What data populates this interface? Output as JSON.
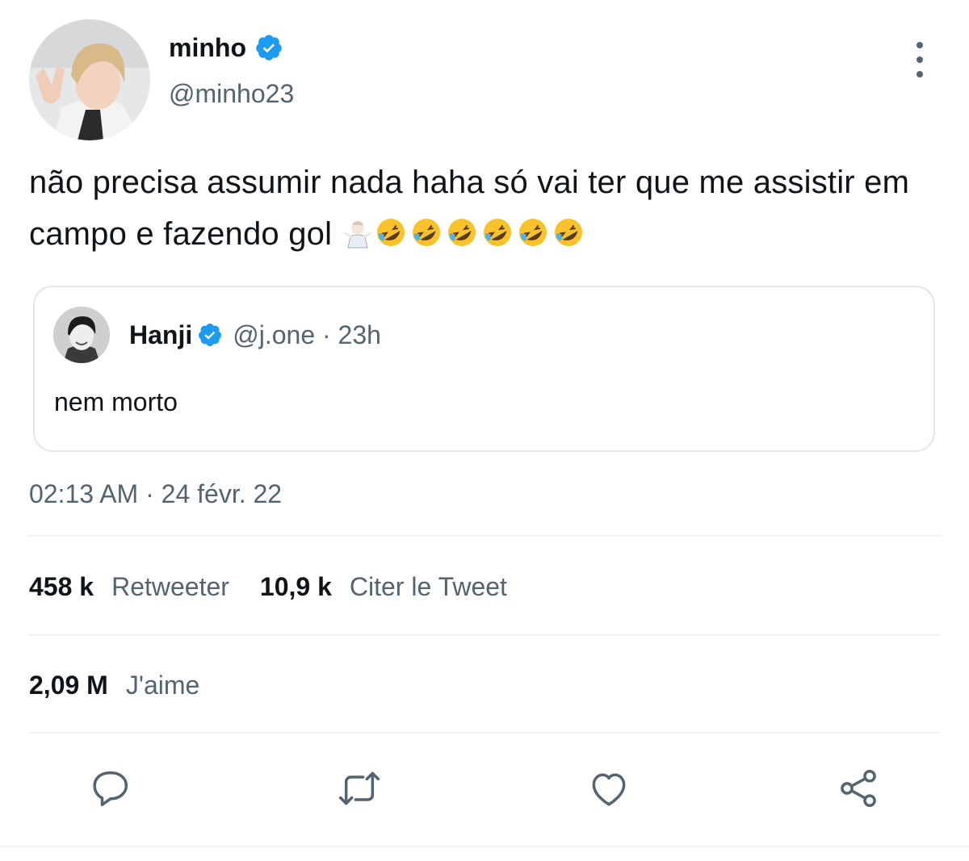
{
  "tweet": {
    "author": {
      "name": "minho",
      "handle": "@minho23",
      "verified": true
    },
    "text": "não precisa assumir nada haha só vai ter que me assistir em campo e fazendo gol",
    "emojis": [
      "man-shrugging-emoji",
      "rolling-on-floor-laughing-emoji",
      "rolling-on-floor-laughing-emoji",
      "rolling-on-floor-laughing-emoji",
      "rolling-on-floor-laughing-emoji",
      "rolling-on-floor-laughing-emoji",
      "rolling-on-floor-laughing-emoji"
    ],
    "timestamp": "02:13 AM · 24 févr. 22"
  },
  "quoted": {
    "name": "Hanji",
    "meta": "@j.one · 23h",
    "verified": true,
    "text": "nem morto"
  },
  "stats": {
    "retweets_count": "458 k",
    "retweets_label": "Retweeter",
    "quotes_count": "10,9 k",
    "quotes_label": "Citer le Tweet",
    "likes_count": "2,09 M",
    "likes_label": "J'aime"
  },
  "actions": [
    "reply-icon",
    "retweet-icon",
    "like-icon",
    "share-icon"
  ],
  "colors": {
    "verified_blue": "#1d9bf0",
    "secondary_text": "#536471",
    "primary_text": "#0f1419",
    "divider": "#eff3f4"
  }
}
